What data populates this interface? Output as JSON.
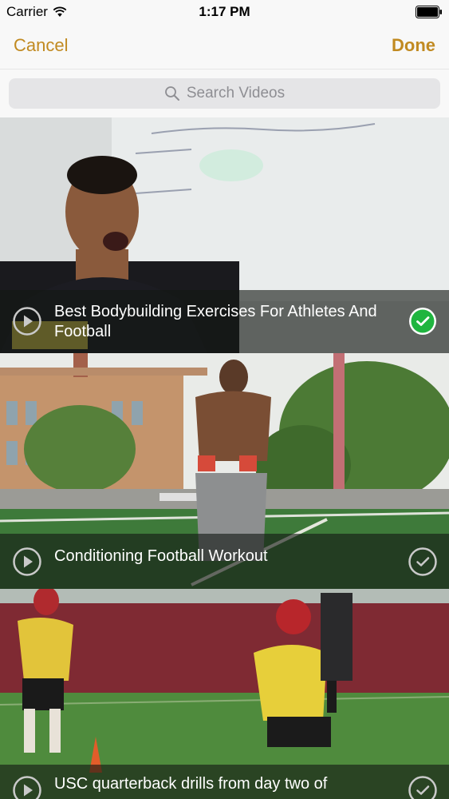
{
  "status_bar": {
    "carrier": "Carrier",
    "time": "1:17 PM",
    "wifi_icon": "wifi-icon",
    "battery_icon": "battery-icon"
  },
  "nav": {
    "cancel_label": "Cancel",
    "done_label": "Done",
    "accent_color": "#c18a21"
  },
  "search": {
    "placeholder": "Search Videos",
    "icon": "search-icon"
  },
  "videos": [
    {
      "title": "Best Bodybuilding Exercises For Athletes And Football",
      "selected": true,
      "play_icon": "play-icon",
      "check_icon": "checkmark-circle-filled-icon"
    },
    {
      "title": "Conditioning Football Workout",
      "selected": false,
      "play_icon": "play-icon",
      "check_icon": "checkmark-circle-outline-icon"
    },
    {
      "title": "USC quarterback drills from day two of",
      "selected": false,
      "play_icon": "play-icon",
      "check_icon": "checkmark-circle-outline-icon"
    }
  ],
  "colors": {
    "selected_green": "#1fb53f",
    "overlay": "rgba(20,24,20,0.62)"
  }
}
